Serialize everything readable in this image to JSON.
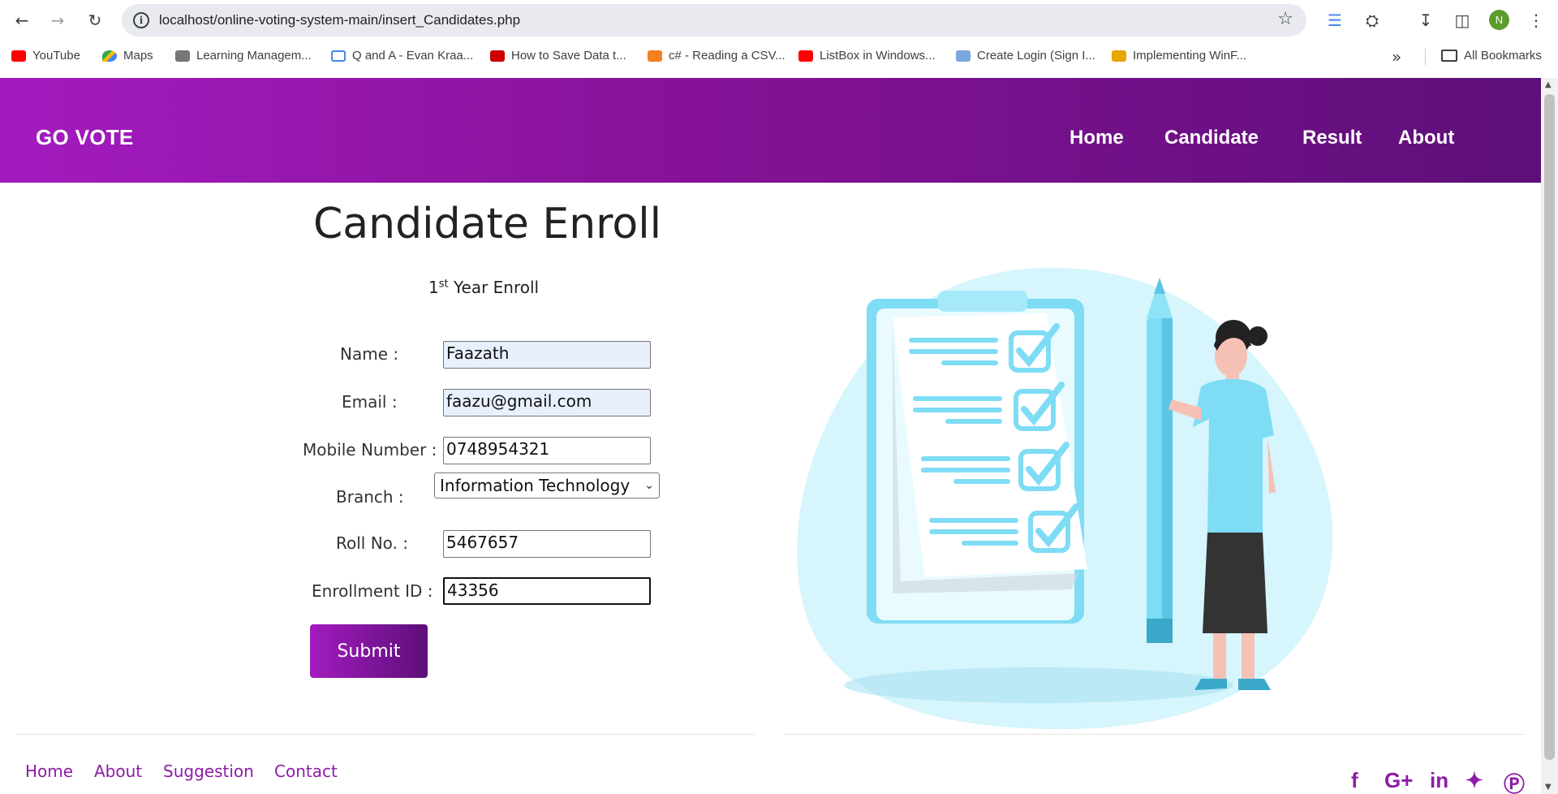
{
  "browser": {
    "url": "localhost/online-voting-system-main/insert_Candidates.php",
    "avatar_letter": "N",
    "bookmarks": [
      {
        "label": "YouTube",
        "icon": "youtube-icon"
      },
      {
        "label": "Maps",
        "icon": "maps-icon"
      },
      {
        "label": "Learning Managem...",
        "icon": "lms-icon"
      },
      {
        "label": "Q and A - Evan Kraa...",
        "icon": "board-icon"
      },
      {
        "label": "How to Save Data t...",
        "icon": "site-icon"
      },
      {
        "label": "c# - Reading a CSV...",
        "icon": "stackoverflow-icon"
      },
      {
        "label": "ListBox in Windows...",
        "icon": "youtube-icon"
      },
      {
        "label": "Create Login (Sign I...",
        "icon": "site-icon"
      },
      {
        "label": "Implementing WinF...",
        "icon": "site-icon"
      }
    ],
    "all_bookmarks": "All Bookmarks"
  },
  "header": {
    "brand": "GO VOTE",
    "menu": [
      "Home",
      "Candidate",
      "Result",
      "About"
    ]
  },
  "form": {
    "title": "Candidate Enroll",
    "subtitle_prefix": "1",
    "subtitle_sup": "st",
    "subtitle_suffix": " Year Enroll",
    "name_label": "Name :",
    "name_value": "Faazath",
    "email_label": "Email :",
    "email_value": "faazu@gmail.com",
    "mobile_label": "Mobile Number :",
    "mobile_value": "0748954321",
    "branch_label": "Branch :",
    "branch_value": "Information Technology",
    "roll_label": "Roll No. :",
    "roll_value": "5467657",
    "enroll_label": "Enrollment ID :",
    "enroll_value": "43356",
    "submit_label": "Submit"
  },
  "footer": {
    "links": [
      "Home",
      "About",
      "Suggestion",
      "Contact"
    ],
    "social": [
      "facebook-icon",
      "google-plus-icon",
      "linkedin-icon",
      "twitter-icon",
      "pinterest-icon"
    ]
  },
  "colors": {
    "header_start": "#a31bbf",
    "header_end": "#5d0f79",
    "footer_link": "#8e1ba6",
    "illustration": "#7fdcf5"
  }
}
